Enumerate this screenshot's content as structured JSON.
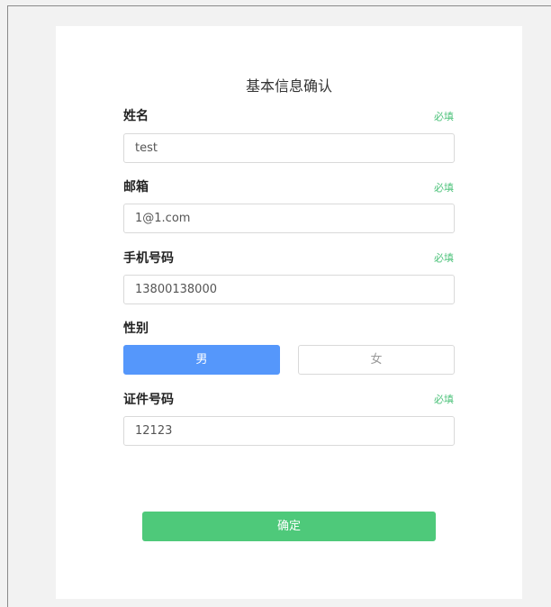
{
  "form": {
    "title": "基本信息确认",
    "required_text": "必填",
    "name": {
      "label": "姓名",
      "value": "test"
    },
    "email": {
      "label": "邮箱",
      "value": "1@1.com"
    },
    "phone": {
      "label": "手机号码",
      "value": "13800138000"
    },
    "gender": {
      "label": "性别",
      "options": [
        "男",
        "女"
      ],
      "selected": "男"
    },
    "id_number": {
      "label": "证件号码",
      "value": "12123"
    },
    "confirm_label": "确定"
  },
  "colors": {
    "page_bg": "#f2f2f2",
    "card_bg": "#ffffff",
    "required_green": "#4cc27a",
    "selected_blue": "#5597fb",
    "confirm_green": "#4ec97a"
  }
}
